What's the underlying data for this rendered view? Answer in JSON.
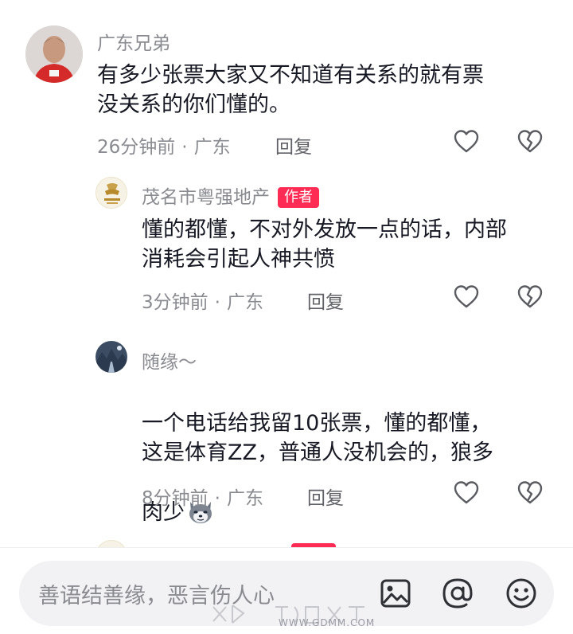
{
  "comments": [
    {
      "author": "广东兄弟",
      "text": "有多少张票大家又不知道有关系的就有票\n没关系的你们懂的。",
      "time": "26分钟前",
      "location": "广东",
      "reply_label": "回复"
    },
    {
      "author": "茂名市粤强地产",
      "badge": "作者",
      "text": "懂的都懂，不对外发放一点的话，内部\n消耗会引起人神共愤",
      "time": "3分钟前",
      "location": "广东",
      "reply_label": "回复"
    },
    {
      "author": "随缘～",
      "text": "一个电话给我留10张票，懂的都懂，\n这是体育ZZ，普通人没机会的，狼多\n肉少",
      "time": "8分钟前",
      "location": "广东",
      "reply_label": "回复"
    }
  ],
  "input": {
    "placeholder": "善语结善缘，恶言伤人心"
  },
  "watermark": {
    "url": "WWW.GDMM.COM"
  },
  "colors": {
    "badge": "#fe2c55",
    "meta_text": "#8a8b91",
    "body_text": "#161823"
  },
  "icons": [
    "heart-icon",
    "broken-heart-icon",
    "image-icon",
    "at-icon",
    "emoji-icon",
    "wolf-emoji-icon"
  ]
}
